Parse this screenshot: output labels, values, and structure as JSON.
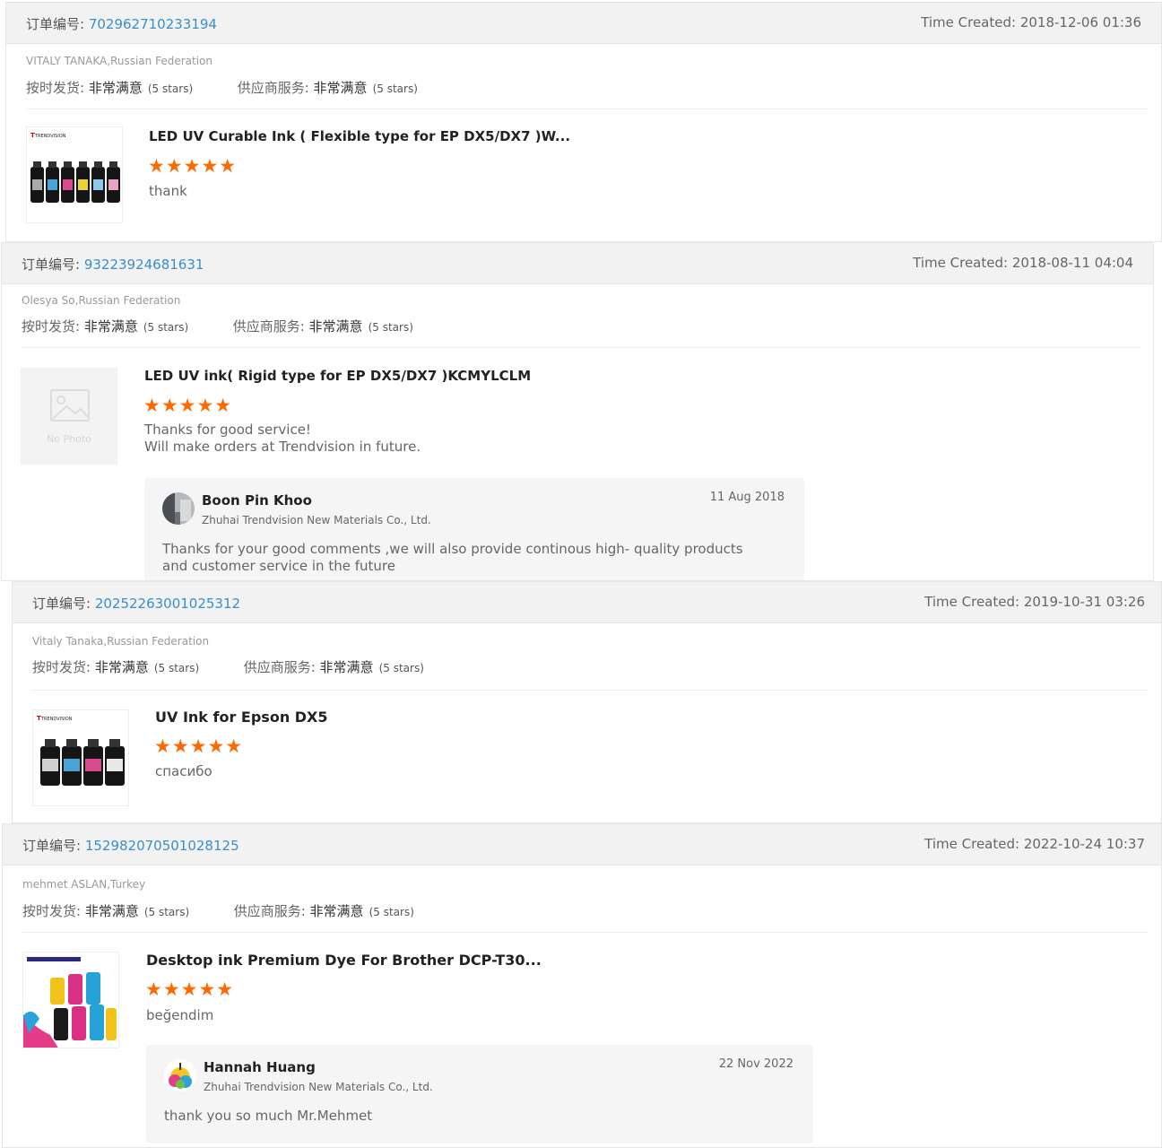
{
  "labels": {
    "order_prefix": "订单编号: ",
    "time_prefix": "Time Created: ",
    "ship_label": "按时发货: ",
    "service_label": "供应商服务: ",
    "very_satisfied": "非常满意",
    "five_stars": "(5 stars)",
    "no_photo": "No Photo"
  },
  "colors": {
    "accent_link": "#3a8ec9",
    "star": "#ff6a00",
    "header_bg": "#f2f2f2"
  },
  "reviews": [
    {
      "order_no": "702962710233194",
      "time": "2018-12-06 01:36",
      "buyer": "VITALY TANAKA,Russian Federation",
      "product": "LED UV Curable Ink ( Flexible type for EP DX5/DX7 )W...",
      "rating": 5,
      "stars_text": "★★★★★",
      "comment": [
        "thank"
      ],
      "brand": "TRENDVISION"
    },
    {
      "order_no": "93223924681631",
      "time": "2018-08-11 04:04",
      "buyer": "Olesya So,Russian Federation",
      "product": "LED UV ink( Rigid type for EP DX5/DX7 )KCMYLCLM",
      "rating": 5,
      "stars_text": "★★★★★",
      "comment": [
        "Thanks for good service!",
        "Will make orders at Trendvision in future."
      ],
      "reply": {
        "name": "Boon Pin Khoo",
        "company": "Zhuhai Trendvision New Materials Co., Ltd.",
        "date": "11 Aug 2018",
        "text": "Thanks for your good comments ,we will also provide continous high- quality products and customer service in the future"
      }
    },
    {
      "order_no": "20252263001025312",
      "time": "2019-10-31 03:26",
      "buyer": "Vitaly Tanaka,Russian Federation",
      "product": "UV Ink for Epson DX5",
      "rating": 5,
      "stars_text": "★★★★★",
      "comment": [
        "спасибо"
      ],
      "brand": "TRENDVISION"
    },
    {
      "order_no": "152982070501028125",
      "time": "2022-10-24 10:37",
      "buyer": "mehmet ASLAN,Turkey",
      "product": "Desktop ink Premium Dye For Brother DCP-T30...",
      "rating": 5,
      "stars_text": "★★★★★",
      "comment": [
        "beğendim"
      ],
      "reply": {
        "name": "Hannah Huang",
        "company": "Zhuhai Trendvision New Materials Co., Ltd.",
        "date": "22 Nov 2022",
        "text": "thank you so much Mr.Mehmet"
      }
    }
  ]
}
